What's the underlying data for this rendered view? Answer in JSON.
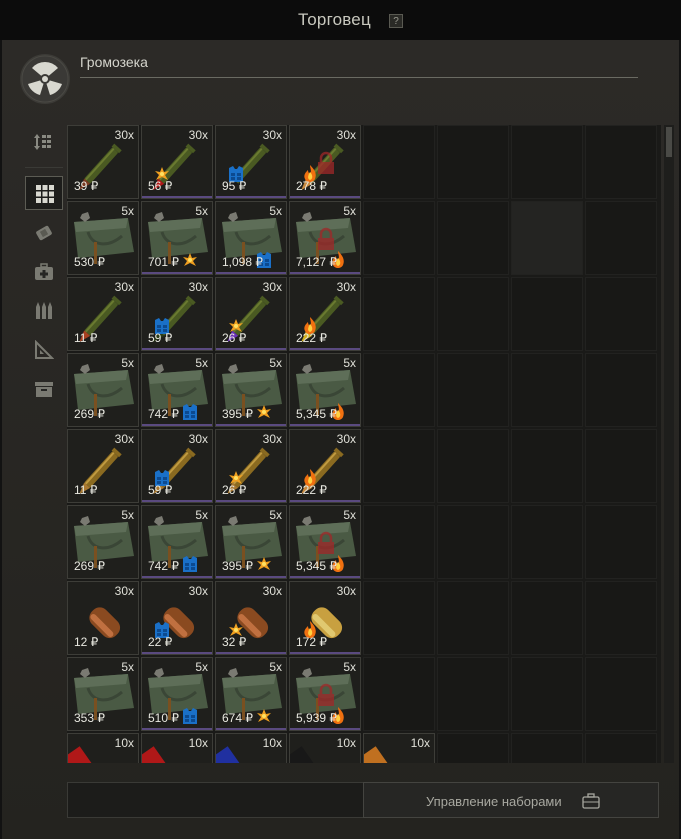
{
  "header": {
    "title": "Торговец",
    "help": "?"
  },
  "trader": {
    "name": "Громозека"
  },
  "sidebar": {
    "items": [
      "sort-icon",
      "grid-icon",
      "bandage-icon",
      "medkit-icon",
      "ammo-icon",
      "ruler-icon",
      "box-icon"
    ]
  },
  "rows": [
    [
      {
        "kind": "bullet",
        "count": "30x",
        "price": "39 ₽",
        "tip": "#7a3a20",
        "effect": ""
      },
      {
        "kind": "bullet",
        "count": "30x",
        "price": "56 ₽",
        "tip": "#b01818",
        "effect": "burst"
      },
      {
        "kind": "bullet",
        "count": "30x",
        "price": "95 ₽",
        "tip": "#181818",
        "effect": "armor"
      },
      {
        "kind": "bullet",
        "count": "30x",
        "price": "278 ₽",
        "tip": "#c88a40",
        "effect": "fire",
        "locked": true
      }
    ],
    [
      {
        "kind": "pack",
        "count": "5x",
        "price": "530 ₽",
        "effect": ""
      },
      {
        "kind": "pack",
        "count": "5x",
        "price": "701 ₽",
        "effect": "burst"
      },
      {
        "kind": "pack",
        "count": "5x",
        "price": "1,098 ₽",
        "effect": "armor"
      },
      {
        "kind": "pack",
        "count": "5x",
        "price": "7,127 ₽",
        "effect": "fire",
        "locked": true
      }
    ],
    [
      {
        "kind": "bullet",
        "count": "30x",
        "price": "11 ₽",
        "tip": "#a84020",
        "effect": ""
      },
      {
        "kind": "bullet",
        "count": "30x",
        "price": "59 ₽",
        "tip": "#2a3a18",
        "effect": "armor"
      },
      {
        "kind": "bullet",
        "count": "30x",
        "price": "26 ₽",
        "tip": "#6a30b8",
        "effect": "burst"
      },
      {
        "kind": "bullet",
        "count": "30x",
        "price": "222 ₽",
        "tip": "#d0b020",
        "effect": "fire"
      }
    ],
    [
      {
        "kind": "pack",
        "count": "5x",
        "price": "269 ₽",
        "effect": ""
      },
      {
        "kind": "pack",
        "count": "5x",
        "price": "742 ₽",
        "effect": "armor"
      },
      {
        "kind": "pack",
        "count": "5x",
        "price": "395 ₽",
        "effect": "burst"
      },
      {
        "kind": "pack",
        "count": "5x",
        "price": "5,345 ₽",
        "effect": "fire"
      }
    ],
    [
      {
        "kind": "bullet",
        "count": "30x",
        "price": "11 ₽",
        "tip": "#a87830",
        "effect": "",
        "gold": true
      },
      {
        "kind": "bullet",
        "count": "30x",
        "price": "59 ₽",
        "tip": "#a87830",
        "effect": "armor",
        "gold": true
      },
      {
        "kind": "bullet",
        "count": "30x",
        "price": "26 ₽",
        "tip": "#a87830",
        "effect": "burst",
        "gold": true
      },
      {
        "kind": "bullet",
        "count": "30x",
        "price": "222 ₽",
        "tip": "#c88a40",
        "effect": "fire",
        "gold": true
      }
    ],
    [
      {
        "kind": "pack",
        "count": "5x",
        "price": "269 ₽",
        "effect": ""
      },
      {
        "kind": "pack",
        "count": "5x",
        "price": "742 ₽",
        "effect": "armor"
      },
      {
        "kind": "pack",
        "count": "5x",
        "price": "395 ₽",
        "effect": "burst"
      },
      {
        "kind": "pack",
        "count": "5x",
        "price": "5,345 ₽",
        "effect": "fire",
        "locked": true
      }
    ],
    [
      {
        "kind": "round",
        "count": "30x",
        "price": "12 ₽",
        "effect": ""
      },
      {
        "kind": "round",
        "count": "30x",
        "price": "22 ₽",
        "effect": "armor"
      },
      {
        "kind": "round",
        "count": "30x",
        "price": "32 ₽",
        "effect": "burst"
      },
      {
        "kind": "round",
        "count": "30x",
        "price": "172 ₽",
        "effect": "fire",
        "brass": true
      }
    ],
    [
      {
        "kind": "pack",
        "count": "5x",
        "price": "353 ₽",
        "effect": ""
      },
      {
        "kind": "pack",
        "count": "5x",
        "price": "510 ₽",
        "effect": "armor"
      },
      {
        "kind": "pack",
        "count": "5x",
        "price": "674 ₽",
        "effect": "burst"
      },
      {
        "kind": "pack",
        "count": "5x",
        "price": "5,939 ₽",
        "effect": "fire",
        "locked": true
      }
    ],
    [
      {
        "kind": "shell",
        "count": "10x",
        "price": "",
        "shellColor": "#b01818"
      },
      {
        "kind": "shell",
        "count": "10x",
        "price": "",
        "shellColor": "#b01818"
      },
      {
        "kind": "shell",
        "count": "10x",
        "price": "",
        "shellColor": "#2030a0"
      },
      {
        "kind": "shell",
        "count": "10x",
        "price": "",
        "shellColor": "#181818"
      },
      {
        "kind": "shell",
        "count": "10x",
        "price": "",
        "shellColor": "#c07020"
      }
    ]
  ],
  "footer": {
    "manage_label": "Управление наборами"
  }
}
